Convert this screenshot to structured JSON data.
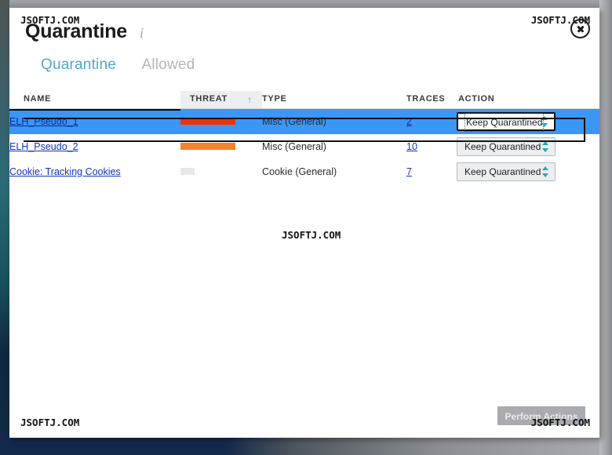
{
  "window": {
    "title": "Quarantine",
    "info_icon": "info-icon",
    "close_label": "×"
  },
  "tabs": [
    {
      "label": "Quarantine",
      "active": true
    },
    {
      "label": "Allowed",
      "active": false
    }
  ],
  "table": {
    "columns": [
      {
        "key": "name",
        "label": "NAME"
      },
      {
        "key": "threat",
        "label": "THREAT",
        "sorted": true,
        "sort_dir": "asc",
        "sort_glyph": "↑"
      },
      {
        "key": "type",
        "label": "TYPE"
      },
      {
        "key": "traces",
        "label": "TRACES"
      },
      {
        "key": "action",
        "label": "ACTION"
      }
    ],
    "rows": [
      {
        "name": "ELH_Pseudo_1",
        "threat_level": "high",
        "threat_color": "#e8340c",
        "threat_width": 70,
        "type": "Misc (General)",
        "traces": "2",
        "action": "Keep Quarantined",
        "selected": true
      },
      {
        "name": "ELH_Pseudo_2",
        "threat_level": "medium",
        "threat_color": "#f4842c",
        "threat_width": 70,
        "type": "Misc (General)",
        "traces": "10",
        "action": "Keep Quarantined",
        "selected": false
      },
      {
        "name": "Cookie: Tracking Cookies",
        "threat_level": "low",
        "threat_color": "#e8e8e8",
        "threat_width": 18,
        "type": "Cookie (General)",
        "traces": "7",
        "action": "Keep Quarantined",
        "selected": false
      }
    ]
  },
  "footer": {
    "perform_actions_label": "Perform Actions",
    "perform_actions_enabled": false
  },
  "watermarks": {
    "top_left": "JSOFTJ.COM",
    "top_right": "JSOFTJ.COM",
    "center": "JSOFTJ.COM",
    "bottom_left": "JSOFTJ.COM",
    "bottom_right": "JSOFTJ.COM"
  },
  "colors": {
    "tab_active": "#4fa7cb",
    "tab_inactive": "#b3b7ba",
    "row_selected_bg": "#3b96f5",
    "link": "#1433c4",
    "threat_header_bg": "#eceeef",
    "spinner": "#2ca2b8"
  }
}
